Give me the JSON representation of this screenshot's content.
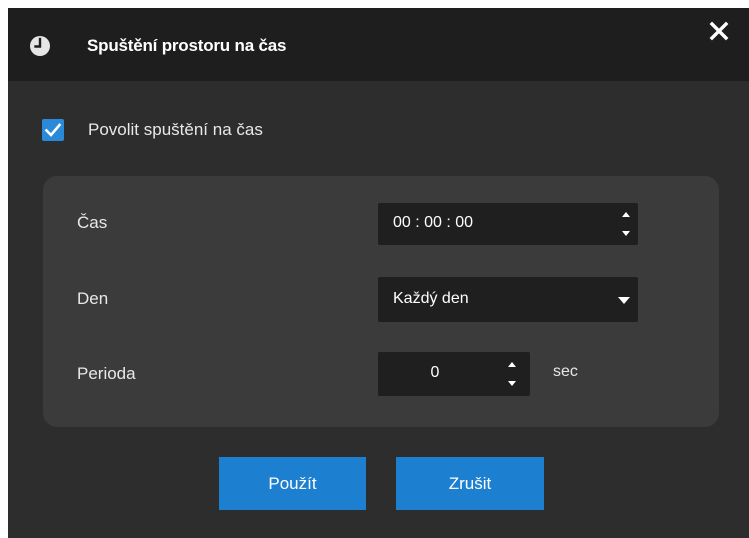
{
  "dialog": {
    "title": "Spuštění prostoru na čas",
    "title_icon": "clock-icon",
    "close_icon": "close-icon"
  },
  "enable": {
    "checked": true,
    "label": "Povolit spuštění na čas"
  },
  "fields": {
    "time_label": "Čas",
    "time_value": "00 : 00 : 00",
    "day_label": "Den",
    "day_value": "Každý den",
    "period_label": "Perioda",
    "period_value": "0",
    "period_unit": "sec"
  },
  "buttons": {
    "apply": "Použít",
    "cancel": "Zrušit"
  },
  "colors": {
    "accent": "#1c7fd0",
    "dialog_bg": "#2d2d2e",
    "panel_bg": "#3b3b3c",
    "input_bg": "#1f1f20"
  }
}
